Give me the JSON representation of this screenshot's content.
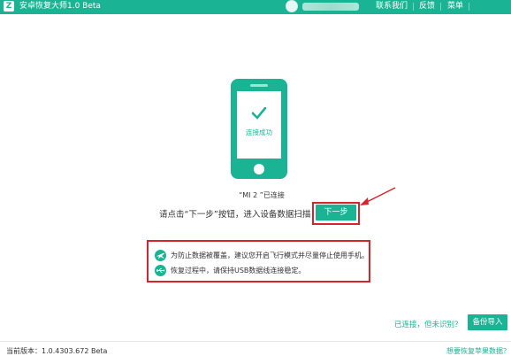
{
  "titlebar": {
    "logo": "Z",
    "title": "安卓恢复大师1.0 Beta",
    "contact_label": "联系我们",
    "feedback_label": "反馈",
    "menu_label": "菜单",
    "accent": "#1ab394"
  },
  "phone": {
    "status_text": "连接成功"
  },
  "main": {
    "device_connected": "“MI 2 ”已连接",
    "instruction": "请点击“下一步”按钮，进入设备数据扫描",
    "next_label": "下一步"
  },
  "tips": [
    {
      "icon": "airplane-icon",
      "text": "为防止数据被覆盖，建议您开启飞行模式并尽量停止使用手机。"
    },
    {
      "icon": "usb-icon",
      "text": "恢复过程中，请保持USB数据线连接稳定。"
    }
  ],
  "bottom": {
    "recognize_link": "已连接，但未识别？",
    "backup_label": "备份导入"
  },
  "footer": {
    "version": "当前版本：1.0.4303.672 Beta",
    "apple_link": "想要恢复苹果数据？"
  }
}
